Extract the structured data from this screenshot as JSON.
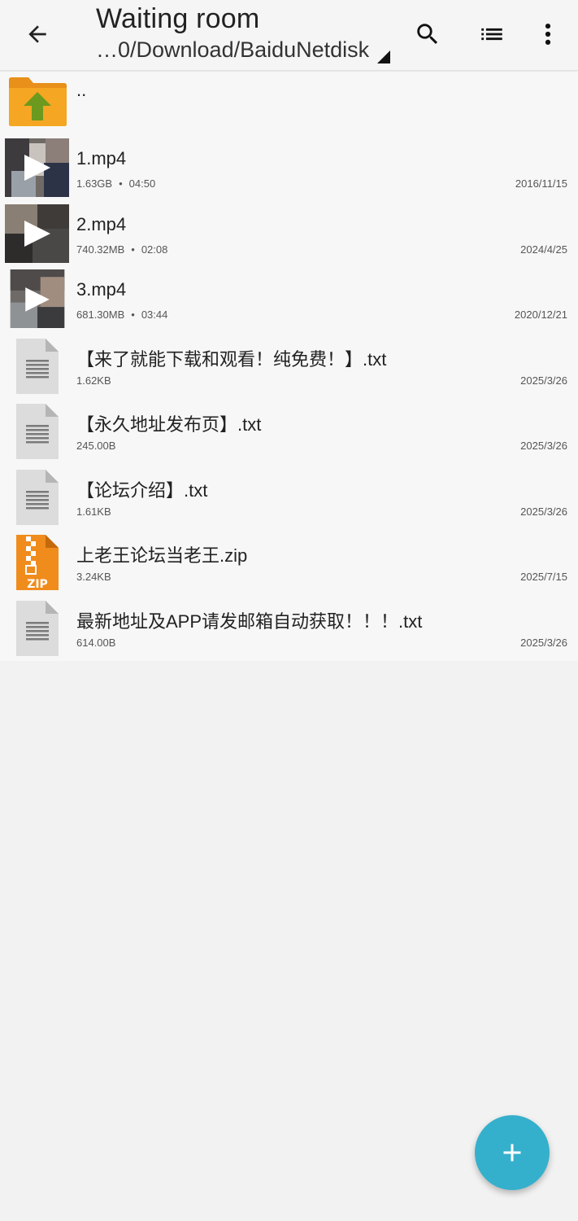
{
  "header": {
    "title": "Waiting room",
    "path": "…0/Download/BaiduNetdisk"
  },
  "parent_label": "..",
  "files": [
    {
      "name": "1.mp4",
      "size": "1.63GB",
      "duration": "04:50",
      "date": "2016/11/15",
      "type": "video"
    },
    {
      "name": "2.mp4",
      "size": "740.32MB",
      "duration": "02:08",
      "date": "2024/4/25",
      "type": "video"
    },
    {
      "name": "3.mp4",
      "size": "681.30MB",
      "duration": "03:44",
      "date": "2020/12/21",
      "type": "video"
    },
    {
      "name": "【来了就能下载和观看！纯免费！】.txt",
      "size": "1.62KB",
      "date": "2025/3/26",
      "type": "text"
    },
    {
      "name": "【永久地址发布页】.txt",
      "size": "245.00B",
      "date": "2025/3/26",
      "type": "text"
    },
    {
      "name": "【论坛介绍】.txt",
      "size": "1.61KB",
      "date": "2025/3/26",
      "type": "text"
    },
    {
      "name": "上老王论坛当老王.zip",
      "size": "3.24KB",
      "date": "2025/7/15",
      "type": "zip"
    },
    {
      "name": "最新地址及APP请发邮箱自动获取！！！.txt",
      "size": "614.00B",
      "date": "2025/3/26",
      "type": "text"
    }
  ],
  "icons": {
    "back": "arrow-left-icon",
    "search": "search-icon",
    "list_view": "list-view-icon",
    "more": "more-vert-icon",
    "fab": "plus-icon"
  },
  "colors": {
    "fab": "#35b0cc",
    "folder": "#f5a623",
    "folder_arrow": "#6b9a1f",
    "zip": "#f08c1c"
  }
}
